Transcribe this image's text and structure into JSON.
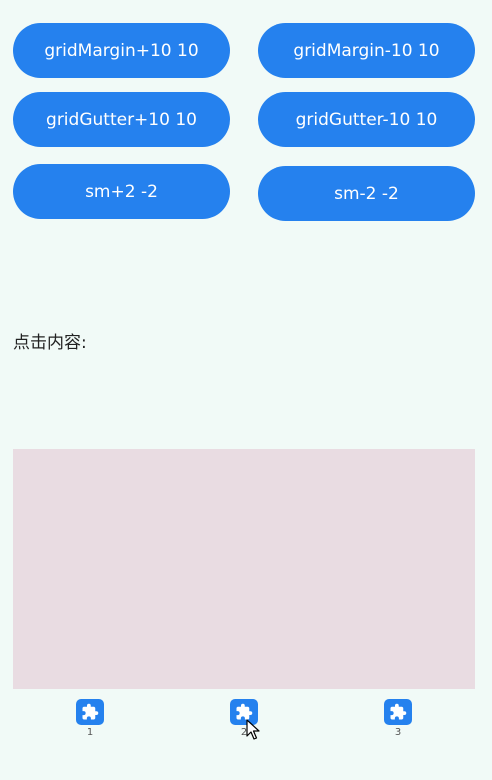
{
  "buttons": {
    "margin_plus": "gridMargin+10 10",
    "margin_minus": "gridMargin-10 10",
    "gutter_plus": "gridGutter+10 10",
    "gutter_minus": "gridGutter-10 10",
    "sm_plus": "sm+2 -2",
    "sm_minus": "sm-2 -2"
  },
  "click_content": {
    "label": "点击内容:",
    "value": ""
  },
  "tabs": [
    {
      "label": "1",
      "icon": "puzzle-icon"
    },
    {
      "label": "2",
      "icon": "puzzle-icon"
    },
    {
      "label": "3",
      "icon": "puzzle-icon"
    }
  ],
  "colors": {
    "background": "#F1FAF7",
    "button": "#2581EE",
    "content_area": "#E9DCE2"
  }
}
